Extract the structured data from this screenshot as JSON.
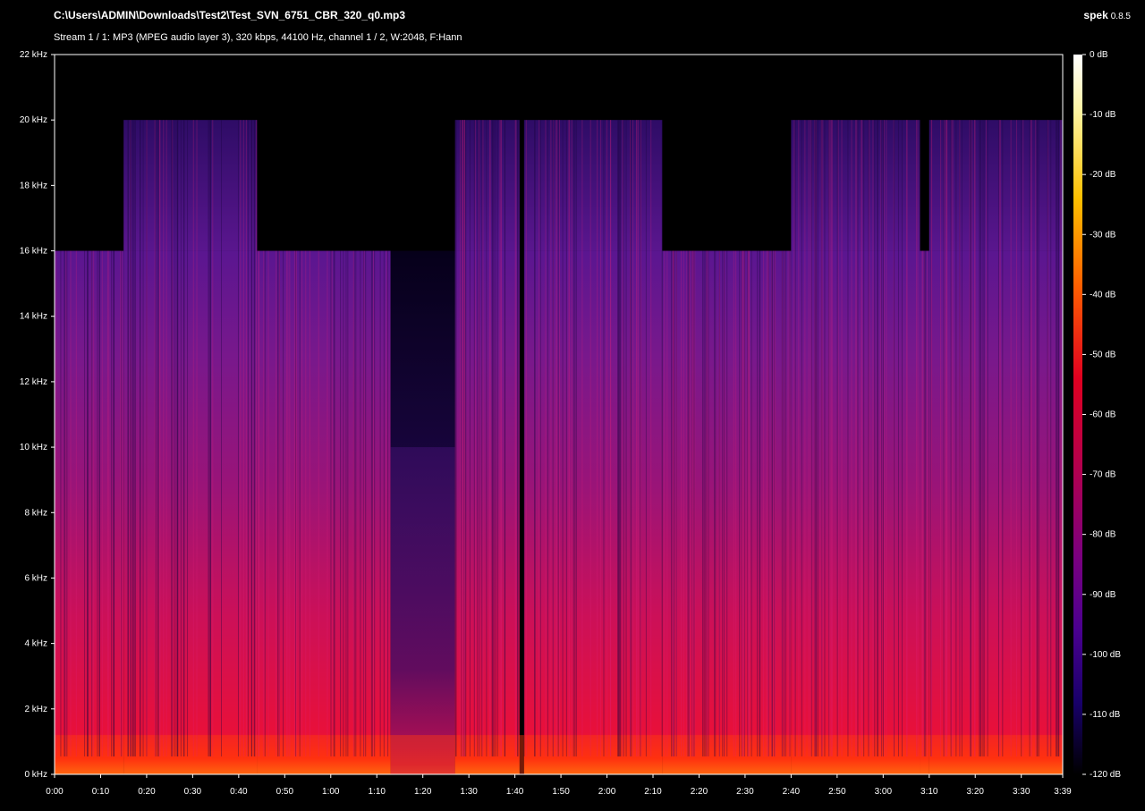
{
  "file_path": "C:\\Users\\ADMIN\\Downloads\\Test2\\Test_SVN_6751_CBR_320_q0.mp3",
  "stream_info": "Stream 1 / 1: MP3 (MPEG audio layer 3), 320 kbps, 44100 Hz, channel 1 / 2, W:2048, F:Hann",
  "app": {
    "name": "spek",
    "version": "0.8.5"
  },
  "chart_data": {
    "type": "heatmap",
    "y_ticks": [
      "0 kHz",
      "2 kHz",
      "4 kHz",
      "6 kHz",
      "8 kHz",
      "10 kHz",
      "12 kHz",
      "14 kHz",
      "16 kHz",
      "18 kHz",
      "20 kHz",
      "22 kHz"
    ],
    "x_ticks": [
      "0:00",
      "0:10",
      "0:20",
      "0:30",
      "0:40",
      "0:50",
      "1:00",
      "1:10",
      "1:20",
      "1:30",
      "1:40",
      "1:50",
      "2:00",
      "2:10",
      "2:20",
      "2:30",
      "2:40",
      "2:50",
      "3:00",
      "3:10",
      "3:20",
      "3:30",
      "3:39"
    ],
    "colorbar_ticks": [
      "0 dB",
      "-10 dB",
      "-20 dB",
      "-30 dB",
      "-40 dB",
      "-50 dB",
      "-60 dB",
      "-70 dB",
      "-80 dB",
      "-90 dB",
      "-100 dB",
      "-110 dB",
      "-120 dB"
    ],
    "duration_s": 219,
    "max_khz": 22,
    "db_range": [
      -120,
      0
    ],
    "lowpass_khz": 16,
    "segments": [
      {
        "t0": 0,
        "t1": 15,
        "top_khz": 16
      },
      {
        "t0": 15,
        "t1": 44,
        "top_khz": 20
      },
      {
        "t0": 44,
        "t1": 73,
        "top_khz": 16
      },
      {
        "t0": 73,
        "t1": 87,
        "top_khz": 10
      },
      {
        "t0": 87,
        "t1": 101,
        "top_khz": 20
      },
      {
        "t0": 102,
        "t1": 132,
        "top_khz": 20
      },
      {
        "t0": 132,
        "t1": 160,
        "top_khz": 16
      },
      {
        "t0": 160,
        "t1": 188,
        "top_khz": 20
      },
      {
        "t0": 188,
        "t1": 190,
        "top_khz": 16
      },
      {
        "t0": 190,
        "t1": 219,
        "top_khz": 20
      }
    ]
  }
}
